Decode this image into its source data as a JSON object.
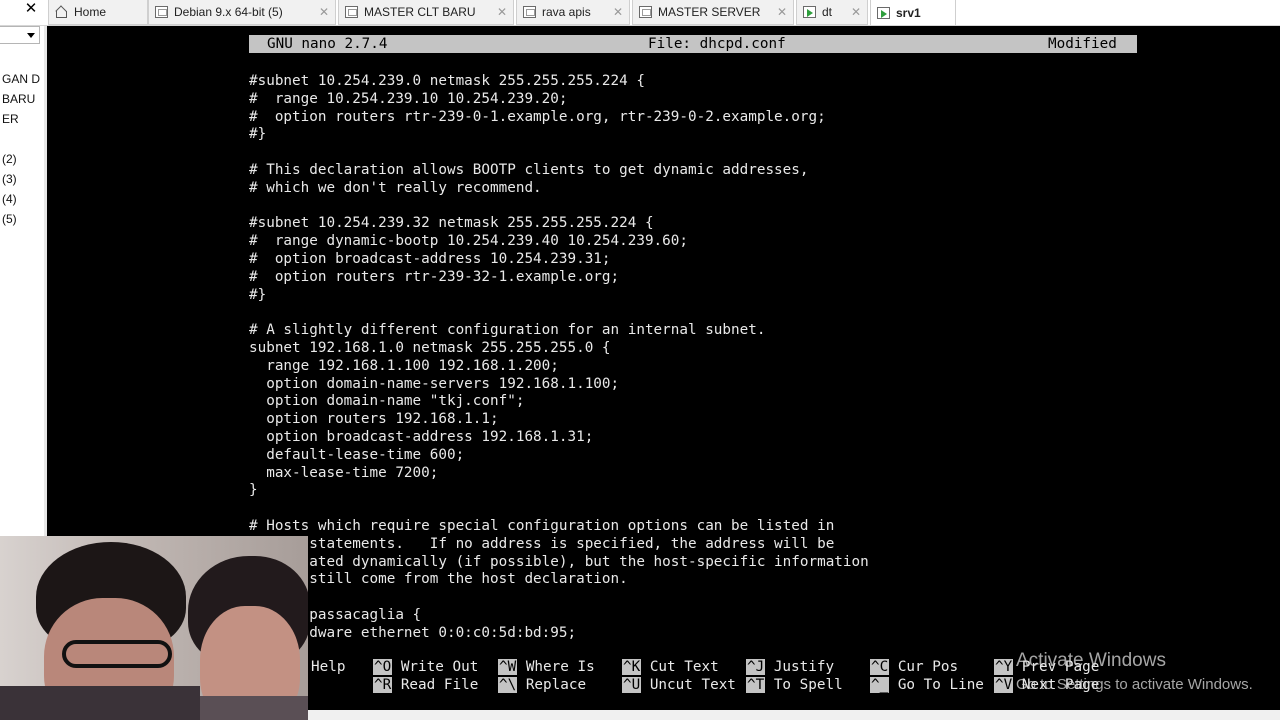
{
  "tabs": [
    {
      "label": "Home",
      "icon": "home-icon",
      "active": false
    },
    {
      "label": "Debian 9.x 64-bit (5)",
      "icon": "vm-icon",
      "active": false
    },
    {
      "label": "MASTER CLT BARU",
      "icon": "vm-icon",
      "active": false
    },
    {
      "label": "rava apis",
      "icon": "vm-icon",
      "active": false
    },
    {
      "label": "MASTER SERVER",
      "icon": "vm-icon",
      "active": false
    },
    {
      "label": "dt",
      "icon": "vm-running-icon",
      "active": false
    },
    {
      "label": "srv1",
      "icon": "vm-running-icon",
      "active": true
    }
  ],
  "left_panel": {
    "items": [
      "GAN D",
      "BARU",
      "ER",
      "(2)",
      "(3)",
      "(4)",
      "(5)"
    ]
  },
  "nano": {
    "version": "GNU nano 2.7.4",
    "file": "File: dhcpd.conf",
    "status": "Modified",
    "lines": [
      "#subnet 10.254.239.0 netmask 255.255.255.224 {",
      "#  range 10.254.239.10 10.254.239.20;",
      "#  option routers rtr-239-0-1.example.org, rtr-239-0-2.example.org;",
      "#}",
      "",
      "# This declaration allows BOOTP clients to get dynamic addresses,",
      "# which we don't really recommend.",
      "",
      "#subnet 10.254.239.32 netmask 255.255.255.224 {",
      "#  range dynamic-bootp 10.254.239.40 10.254.239.60;",
      "#  option broadcast-address 10.254.239.31;",
      "#  option routers rtr-239-32-1.example.org;",
      "#}",
      "",
      "# A slightly different configuration for an internal subnet.",
      "subnet 192.168.1.0 netmask 255.255.255.0 {",
      "  range 192.168.1.100 192.168.1.200;",
      "  option domain-name-servers 192.168.1.100;",
      "  option domain-name \"tkj.conf\";",
      "  option routers 192.168.1.1;",
      "  option broadcast-address 192.168.1.31;",
      "  default-lease-time 600;",
      "  max-lease-time 7200;",
      "}",
      "",
      "# Hosts which require special configuration options can be listed in",
      "       statements.   If no address is specified, the address will be",
      "       ated dynamically (if possible), but the host-specific information",
      "       still come from the host declaration.",
      "",
      "       passacaglia {",
      "       dware ethernet 0:0:c0:5d:bd:95;"
    ],
    "shortcuts_row1": [
      {
        "key": "",
        "label": "Help"
      },
      {
        "key": "^O",
        "label": "Write Out"
      },
      {
        "key": "^W",
        "label": "Where Is"
      },
      {
        "key": "^K",
        "label": "Cut Text"
      },
      {
        "key": "^J",
        "label": "Justify"
      },
      {
        "key": "^C",
        "label": "Cur Pos"
      },
      {
        "key": "^Y",
        "label": "Prev Page"
      }
    ],
    "shortcuts_row2": [
      {
        "key": "^R",
        "label": "Read File"
      },
      {
        "key": "^\\",
        "label": "Replace"
      },
      {
        "key": "^U",
        "label": "Uncut Text"
      },
      {
        "key": "^T",
        "label": "To Spell"
      },
      {
        "key": "^_",
        "label": "Go To Line"
      },
      {
        "key": "^V",
        "label": "Next Page"
      }
    ]
  },
  "watermark": {
    "title": "Activate Windows",
    "subtitle": "Go to Settings to activate Windows."
  },
  "colors": {
    "console_bg": "#000000",
    "nano_bar": "#c4c4c4",
    "text": "#e9e9e9"
  }
}
